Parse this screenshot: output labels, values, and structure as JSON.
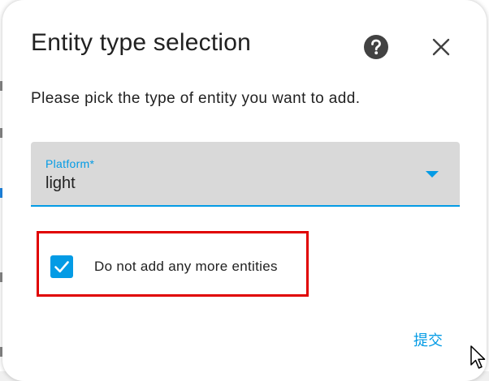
{
  "dialog": {
    "title": "Entity type selection",
    "help_icon": "help-circle-icon",
    "close_icon": "close-icon",
    "description": "Please pick the type of entity you want to add."
  },
  "platform_select": {
    "label": "Platform*",
    "value": "light",
    "dropdown_icon": "chevron-down-icon"
  },
  "option": {
    "checked": true,
    "label": "Do not add any more entities"
  },
  "actions": {
    "submit_label": "提交"
  },
  "colors": {
    "accent": "#039be5",
    "highlight": "#e00000",
    "field_background": "#d9d9d9",
    "text": "#212121"
  }
}
